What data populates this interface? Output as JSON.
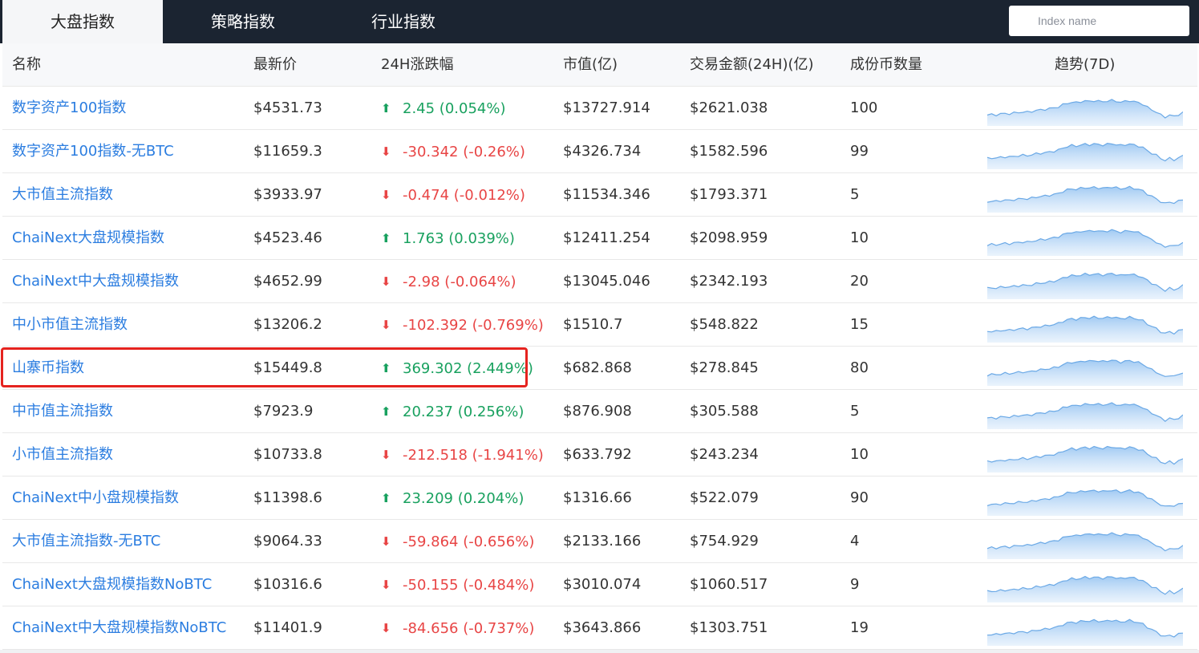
{
  "tabs": [
    {
      "label": "大盘指数",
      "active": true
    },
    {
      "label": "策略指数",
      "active": false
    },
    {
      "label": "行业指数",
      "active": false
    }
  ],
  "search": {
    "placeholder": "Index name",
    "value": ""
  },
  "columns": [
    "名称",
    "最新价",
    "24H涨跌幅",
    "市值(亿)",
    "交易金额(24H)(亿)",
    "成份币数量",
    "趋势(7D)"
  ],
  "colors": {
    "up": "#19a15f",
    "down": "#e84545",
    "link": "#2b7de0",
    "highlight": "#e5231f",
    "sparkline": "#6ba9e6"
  },
  "rows": [
    {
      "name": "数字资产100指数",
      "price": "$4531.73",
      "direction": "up",
      "change": "2.45 (0.054%)",
      "market_cap": "$13727.914",
      "volume": "$2621.038",
      "count": "100"
    },
    {
      "name": "数字资产100指数-无BTC",
      "price": "$11659.3",
      "direction": "down",
      "change": "-30.342 (-0.26%)",
      "market_cap": "$4326.734",
      "volume": "$1582.596",
      "count": "99"
    },
    {
      "name": "大市值主流指数",
      "price": "$3933.97",
      "direction": "down",
      "change": "-0.474 (-0.012%)",
      "market_cap": "$11534.346",
      "volume": "$1793.371",
      "count": "5"
    },
    {
      "name": "ChaiNext大盘规模指数",
      "price": "$4523.46",
      "direction": "up",
      "change": "1.763 (0.039%)",
      "market_cap": "$12411.254",
      "volume": "$2098.959",
      "count": "10"
    },
    {
      "name": "ChaiNext中大盘规模指数",
      "price": "$4652.99",
      "direction": "down",
      "change": "-2.98 (-0.064%)",
      "market_cap": "$13045.046",
      "volume": "$2342.193",
      "count": "20"
    },
    {
      "name": "中小市值主流指数",
      "price": "$13206.2",
      "direction": "down",
      "change": "-102.392 (-0.769%)",
      "market_cap": "$1510.7",
      "volume": "$548.822",
      "count": "15"
    },
    {
      "name": "山寨币指数",
      "price": "$15449.8",
      "direction": "up",
      "change": "369.302 (2.449%)",
      "market_cap": "$682.868",
      "volume": "$278.845",
      "count": "80",
      "highlighted": true
    },
    {
      "name": "中市值主流指数",
      "price": "$7923.9",
      "direction": "up",
      "change": "20.237 (0.256%)",
      "market_cap": "$876.908",
      "volume": "$305.588",
      "count": "5"
    },
    {
      "name": "小市值主流指数",
      "price": "$10733.8",
      "direction": "down",
      "change": "-212.518 (-1.941%)",
      "market_cap": "$633.792",
      "volume": "$243.234",
      "count": "10"
    },
    {
      "name": "ChaiNext中小盘规模指数",
      "price": "$11398.6",
      "direction": "up",
      "change": "23.209 (0.204%)",
      "market_cap": "$1316.66",
      "volume": "$522.079",
      "count": "90"
    },
    {
      "name": "大市值主流指数-无BTC",
      "price": "$9064.33",
      "direction": "down",
      "change": "-59.864 (-0.656%)",
      "market_cap": "$2133.166",
      "volume": "$754.929",
      "count": "4"
    },
    {
      "name": "ChaiNext大盘规模指数NoBTC",
      "price": "$10316.6",
      "direction": "down",
      "change": "-50.155 (-0.484%)",
      "market_cap": "$3010.074",
      "volume": "$1060.517",
      "count": "9"
    },
    {
      "name": "ChaiNext中大盘规模指数NoBTC",
      "price": "$11401.9",
      "direction": "down",
      "change": "-84.656 (-0.737%)",
      "market_cap": "$3643.866",
      "volume": "$1303.751",
      "count": "19"
    }
  ]
}
